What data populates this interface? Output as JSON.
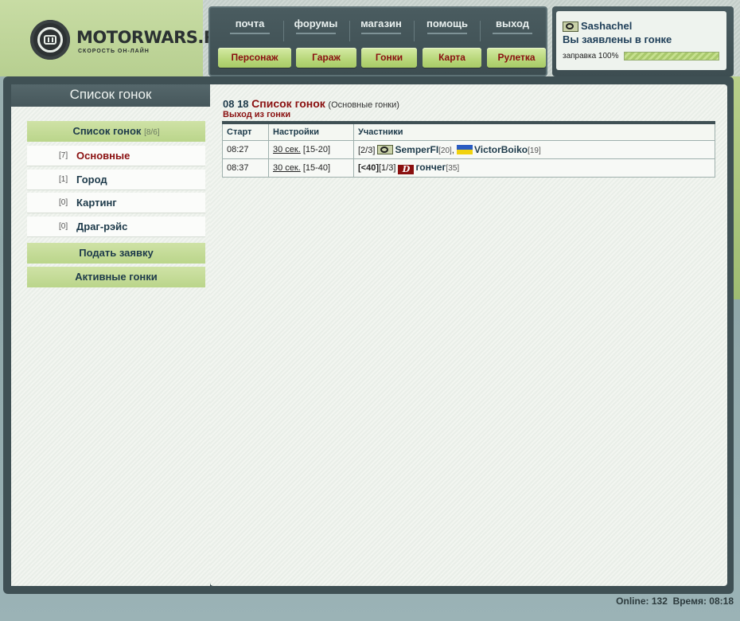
{
  "logo": {
    "title": "MOTORWARS.RU",
    "subtitle": "СКОРОСТЬ ОН-ЛАЙН"
  },
  "nav": {
    "top": [
      "почта",
      "форумы",
      "магазин",
      "помощь",
      "выход"
    ],
    "buttons": [
      "Персонаж",
      "Гараж",
      "Гонки",
      "Карта",
      "Рулетка"
    ]
  },
  "user": {
    "name": "Sashachel",
    "status": "Вы заявлены в гонке",
    "fuel_label": "заправка 100%",
    "fuel_percent": 100
  },
  "sidebar": {
    "title": "Список гонок",
    "list_header": {
      "label": "Список гонок",
      "count": "[8/6]"
    },
    "items": [
      {
        "count": "[7]",
        "label": "Основные",
        "active": true
      },
      {
        "count": "[1]",
        "label": "Город",
        "active": false
      },
      {
        "count": "[0]",
        "label": "Картинг",
        "active": false
      },
      {
        "count": "[0]",
        "label": "Драг-рэйс",
        "active": false
      }
    ],
    "actions": [
      "Подать заявку",
      "Активные гонки"
    ]
  },
  "content": {
    "time": "08 18",
    "title": "Список гонок",
    "subtitle": "(Основные гонки)",
    "exit_link": "Выход из гонки",
    "table": {
      "headers": [
        "Старт",
        "Настройки",
        "Участники"
      ],
      "rows": [
        {
          "start": "08:27",
          "setting": "30 сек.",
          "range": "[15-20]",
          "prefix": "[2/3]",
          "participants": [
            {
              "icon": "club-flag-icon",
              "name": "SemperFI",
              "level": "[20]",
              "sep": ","
            },
            {
              "icon": "ukraine-flag-icon",
              "name": "VictorBoiko",
              "level": "[19]",
              "sep": ""
            }
          ]
        },
        {
          "start": "08:37",
          "setting": "30 сек.",
          "range": "[15-40]",
          "prefix_bold": "[<40]",
          "prefix": "[1/3]",
          "participants": [
            {
              "icon": "d-badge-icon",
              "name": "гончег",
              "level": "[35]",
              "sep": ""
            }
          ]
        }
      ]
    }
  },
  "footer": {
    "online_label": "Online:",
    "online": "132",
    "time_label": "Время:",
    "time": "08:18"
  },
  "icons": {
    "d_badge_letter": "D"
  },
  "colors": {
    "accent_red": "#8a1010",
    "text_navy": "#1d3a4a",
    "button_green": "#b9d87c",
    "frame": "#3f5054"
  }
}
